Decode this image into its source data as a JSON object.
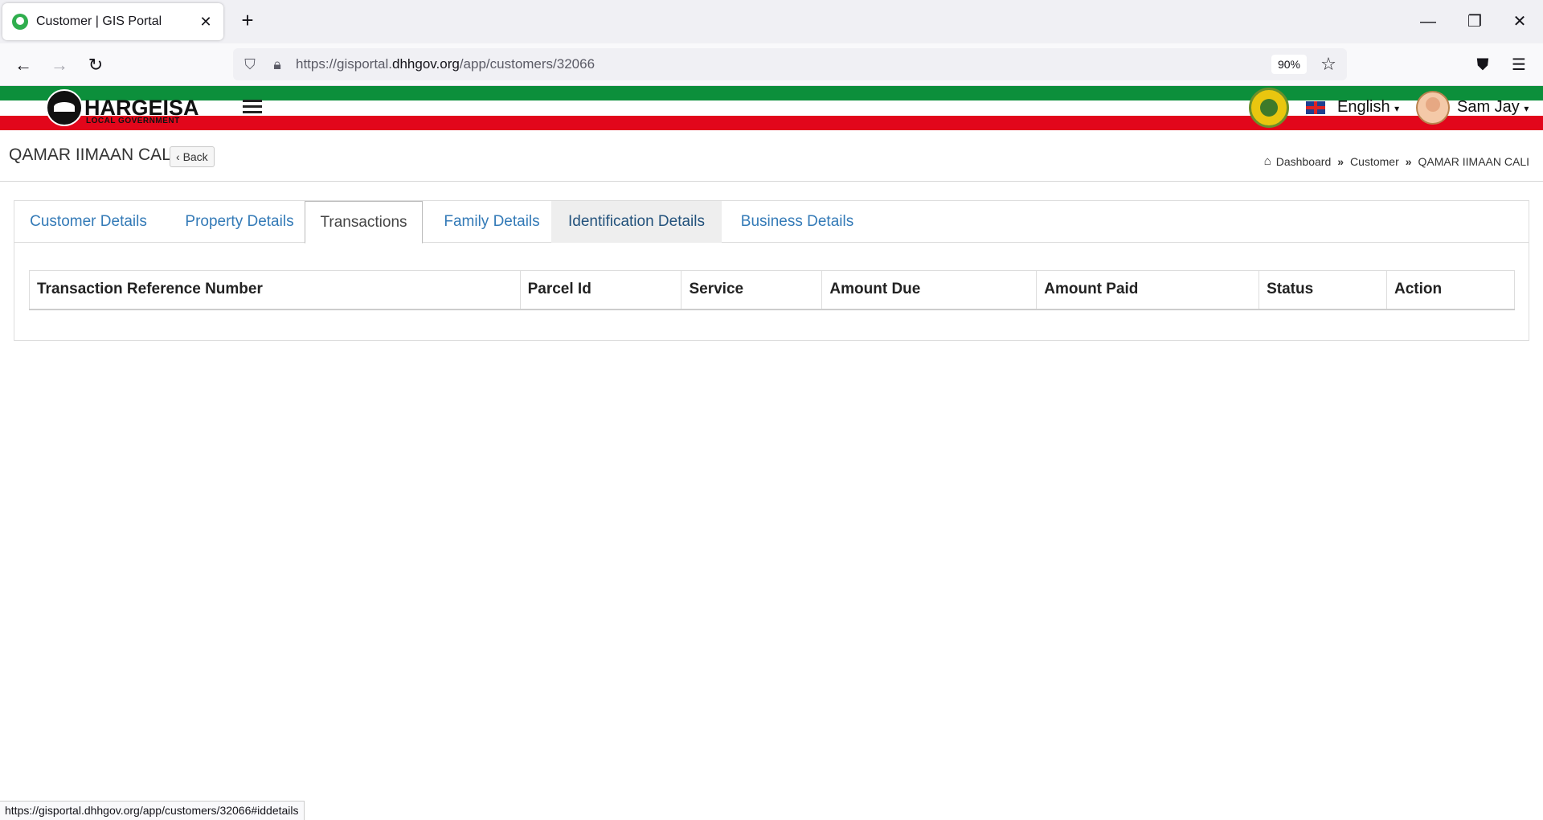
{
  "browser": {
    "tab_title": "Customer | GIS Portal",
    "url_prefix": "https://gisportal.",
    "url_host": "dhhgov.org",
    "url_path": "/app/customers/32066",
    "zoom": "90%",
    "status_url": "https://gisportal.dhhgov.org/app/customers/32066#iddetails"
  },
  "header": {
    "logo_title": "HARGEISA",
    "logo_subtitle": "LOCAL GOVERNMENT",
    "language": "English",
    "user_name": "Sam Jay"
  },
  "page": {
    "title": "QAMAR IIMAAN CALI",
    "back_label": "Back",
    "breadcrumb": [
      "Dashboard",
      "Customer",
      "QAMAR IIMAAN CALI"
    ]
  },
  "tabs": [
    {
      "label": "Customer Details"
    },
    {
      "label": "Property Details"
    },
    {
      "label": "Transactions"
    },
    {
      "label": "Family Details"
    },
    {
      "label": "Identification Details"
    },
    {
      "label": "Business Details"
    }
  ],
  "table": {
    "columns": [
      "Transaction Reference Number",
      "Parcel Id",
      "Service",
      "Amount Due",
      "Amount Paid",
      "Status",
      "Action"
    ]
  }
}
